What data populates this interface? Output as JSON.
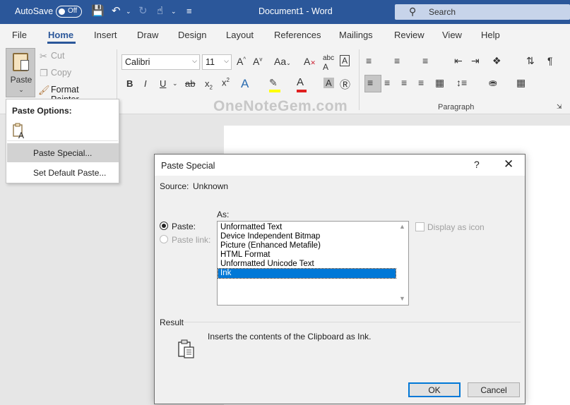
{
  "titlebar": {
    "autosave_label": "AutoSave",
    "autosave_state": "Off",
    "doc_title": "Document1  -  Word",
    "search_placeholder": "Search",
    "colors": {
      "bar": "#2b579a",
      "search_bg": "#c7d4ea"
    }
  },
  "tabs": [
    "File",
    "Home",
    "Insert",
    "Draw",
    "Design",
    "Layout",
    "References",
    "Mailings",
    "Review",
    "View",
    "Help"
  ],
  "active_tab": "Home",
  "clipboard": {
    "paste_label": "Paste",
    "cut_label": "Cut",
    "copy_label": "Copy",
    "format_painter_label": "Format Painter"
  },
  "font": {
    "name": "Calibri",
    "size": "11"
  },
  "paragraph_group_label": "Paragraph",
  "paste_menu": {
    "header": "Paste Options:",
    "paste_special": "Paste Special...",
    "set_default": "Set Default Paste..."
  },
  "watermark": "OneNoteGem.com",
  "dialog": {
    "title": "Paste Special",
    "help": "?",
    "source_label": "Source:",
    "source_value": "Unknown",
    "as_label": "As:",
    "paste_option": "Paste:",
    "paste_link_option": "Paste link:",
    "formats": [
      "Unformatted Text",
      "Device Independent Bitmap",
      "Picture (Enhanced Metafile)",
      "HTML Format",
      "Unformatted Unicode Text",
      "Ink"
    ],
    "selected_format": "Ink",
    "display_as_icon": "Display as icon",
    "result_label": "Result",
    "result_text": "Inserts the contents of the Clipboard as Ink.",
    "ok": "OK",
    "cancel": "Cancel",
    "colors": {
      "selection": "#0078d7"
    }
  }
}
